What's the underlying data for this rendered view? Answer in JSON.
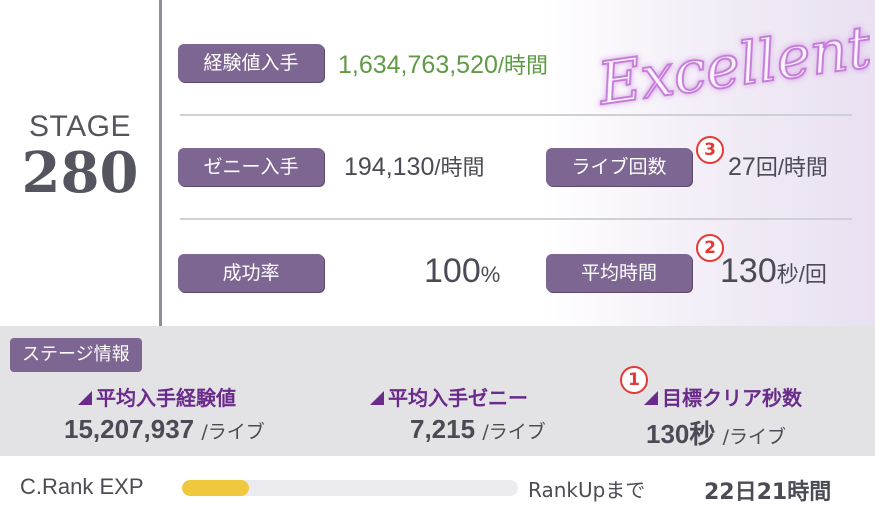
{
  "stage": {
    "label": "STAGE",
    "number": "280"
  },
  "badge_text": "Excellent",
  "rows": {
    "exp": {
      "tag": "経験値入手",
      "value": "1,634,763,520",
      "unit": "/時間"
    },
    "zeny": {
      "tag": "ゼニー入手",
      "value": "194,130",
      "unit": "/時間"
    },
    "live_count": {
      "tag": "ライブ回数",
      "marker": "3",
      "value": "27",
      "unit": "回/時間"
    },
    "success": {
      "tag": "成功率",
      "value": "100",
      "unit": "%"
    },
    "avg_time": {
      "tag": "平均時間",
      "marker": "2",
      "value": "130",
      "unit": "秒/回"
    }
  },
  "stage_info": {
    "tag": "ステージ情報",
    "stats": [
      {
        "label": "平均入手経験値",
        "value": "15,207,937",
        "unit": "/ライブ"
      },
      {
        "label": "平均入手ゼニー",
        "value": "7,215",
        "unit": "/ライブ"
      },
      {
        "label": "目標クリア秒数",
        "marker": "1",
        "value": "130秒",
        "unit": "/ライブ"
      }
    ]
  },
  "bottom": {
    "exp_label": "C.Rank EXP",
    "progress": 0.2,
    "rankup_label": "RankUpまで",
    "rankup_time": "22日21時間"
  },
  "colors": {
    "tag": "#7d6691",
    "green": "#5f9a45",
    "purple_label": "#6a2b8b",
    "marker": "#e53935",
    "progress_fill": "#efc83e"
  }
}
